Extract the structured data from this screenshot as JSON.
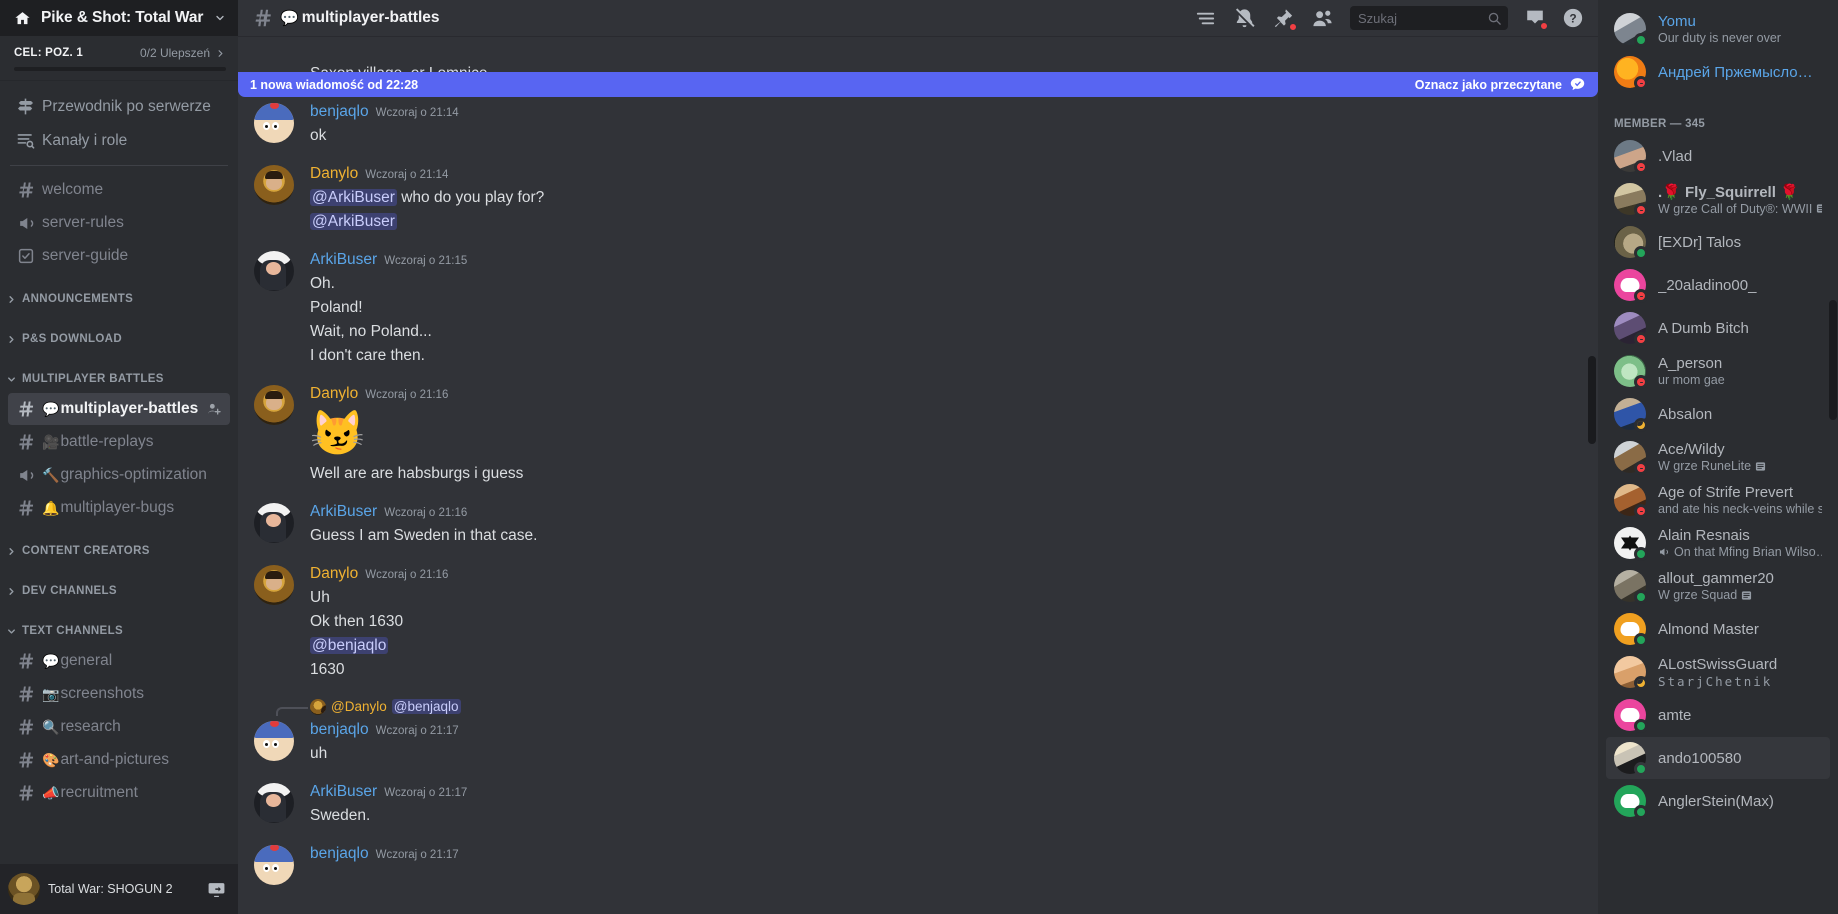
{
  "sidebar": {
    "server_name": "Pike & Shot: Total War",
    "quest": {
      "label": "CEL: POZ. 1",
      "count": "0/2 Ulepszeń"
    },
    "nav": [
      {
        "label": "Przewodnik po serwerze",
        "icon": "signpost-icon"
      },
      {
        "label": "Kanały i role",
        "icon": "channels-and-roles-icon"
      }
    ],
    "top_channels": [
      {
        "name": "welcome",
        "icon": "hash-icon",
        "emoji": ""
      },
      {
        "name": "server-rules",
        "icon": "announcement-icon",
        "emoji": ""
      },
      {
        "name": "server-guide",
        "icon": "guide-icon",
        "emoji": ""
      }
    ],
    "categories": [
      {
        "label": "ANNOUNCEMENTS",
        "open": false,
        "channels": []
      },
      {
        "label": "P&S DOWNLOAD",
        "open": false,
        "channels": []
      },
      {
        "label": "MULTIPLAYER BATTLES",
        "open": true,
        "channels": [
          {
            "name": "multiplayer-battles",
            "icon": "hash-icon",
            "emoji": "💬",
            "active": true,
            "extra": "add-member-icon"
          },
          {
            "name": "battle-replays",
            "icon": "hash-icon",
            "emoji": "🎥",
            "active": false
          },
          {
            "name": "graphics-optimization",
            "icon": "announcement-icon",
            "emoji": "🔨",
            "active": false
          },
          {
            "name": "multiplayer-bugs",
            "icon": "hash-icon",
            "emoji": "🔔",
            "active": false
          }
        ]
      },
      {
        "label": "CONTENT CREATORS",
        "open": false,
        "channels": []
      },
      {
        "label": "DEV CHANNELS",
        "open": false,
        "channels": []
      },
      {
        "label": "TEXT CHANNELS",
        "open": true,
        "channels": [
          {
            "name": "general",
            "icon": "hash-icon",
            "emoji": "💬",
            "active": false
          },
          {
            "name": "screenshots",
            "icon": "hash-icon",
            "emoji": "📷",
            "active": false
          },
          {
            "name": "research",
            "icon": "hash-icon",
            "emoji": "🔍",
            "active": false
          },
          {
            "name": "art-and-pictures",
            "icon": "hash-icon",
            "emoji": "🎨",
            "active": false
          },
          {
            "name": "recruitment",
            "icon": "hash-icon",
            "emoji": "📣",
            "active": false
          }
        ]
      }
    ],
    "user_panel": {
      "game": "Total War: SHOGUN 2",
      "share_icon": "screen-share-icon"
    }
  },
  "topbar": {
    "hash_icon": "hash-icon",
    "channel_emoji": "💬",
    "channel_name": "multiplayer-battles",
    "actions": [
      {
        "name": "threads-icon"
      },
      {
        "name": "notifications-muted-icon",
        "badge": true
      },
      {
        "name": "pinned-messages-icon",
        "badge": true
      },
      {
        "name": "member-list-icon"
      }
    ],
    "search": {
      "placeholder": "Szukaj",
      "value": "",
      "icon": "search-icon"
    },
    "inbox": {
      "name": "inbox-icon",
      "badge": true
    },
    "help": {
      "name": "help-icon"
    }
  },
  "new_messages_banner": {
    "left": "1 nowa wiadomość od 22:28",
    "right": "Oznacz jako przeczytane",
    "icon": "mark-read-icon",
    "color": "#5865f2"
  },
  "chat": {
    "top_partial_line": "Saxon village, or Lomnice",
    "messages": [
      {
        "author": "benjaqlo",
        "author_class": "benjaqlo",
        "avatar": "a-stan",
        "timestamp": "Wczoraj o 21:14",
        "lines": [
          {
            "type": "text",
            "text": "ok"
          }
        ]
      },
      {
        "author": "Danylo",
        "author_class": "danylo",
        "avatar": "a-danylo",
        "timestamp": "Wczoraj o 21:14",
        "lines": [
          {
            "type": "mention_text",
            "mention": "@ArkiBuser",
            "text": " who do you play for?"
          },
          {
            "type": "mention_only",
            "mention": "@ArkiBuser"
          }
        ]
      },
      {
        "author": "ArkiBuser",
        "author_class": "arkibuser",
        "avatar": "a-arki",
        "timestamp": "Wczoraj o 21:15",
        "lines": [
          {
            "type": "text",
            "text": "Oh."
          },
          {
            "type": "text",
            "text": "Poland!"
          },
          {
            "type": "text",
            "text": "Wait, no Poland..."
          },
          {
            "type": "text",
            "text": "I don't care then."
          }
        ]
      },
      {
        "author": "Danylo",
        "author_class": "danylo",
        "avatar": "a-danylo",
        "timestamp": "Wczoraj o 21:16",
        "lines": [
          {
            "type": "bigemoji",
            "text": "😼"
          },
          {
            "type": "text",
            "text": "Well are are habsburgs i guess"
          }
        ]
      },
      {
        "author": "ArkiBuser",
        "author_class": "arkibuser",
        "avatar": "a-arki",
        "timestamp": "Wczoraj o 21:16",
        "lines": [
          {
            "type": "text",
            "text": "Guess I am Sweden in that case."
          }
        ]
      },
      {
        "author": "Danylo",
        "author_class": "danylo",
        "avatar": "a-danylo",
        "timestamp": "Wczoraj o 21:16",
        "lines": [
          {
            "type": "text",
            "text": "Uh"
          },
          {
            "type": "text",
            "text": "Ok then 1630"
          },
          {
            "type": "mention_only",
            "mention": "@benjaqlo"
          },
          {
            "type": "text",
            "text": "1630"
          }
        ]
      },
      {
        "author": "benjaqlo",
        "author_class": "benjaqlo",
        "avatar": "a-stan",
        "timestamp": "Wczoraj o 21:17",
        "reply": {
          "avatar": "a-danylo",
          "name": "@Danylo",
          "mention": "@benjaqlo"
        },
        "lines": [
          {
            "type": "text",
            "text": "uh"
          }
        ]
      },
      {
        "author": "ArkiBuser",
        "author_class": "arkibuser",
        "avatar": "a-arki",
        "timestamp": "Wczoraj o 21:17",
        "lines": [
          {
            "type": "text",
            "text": "Sweden."
          }
        ]
      },
      {
        "author": "benjaqlo",
        "author_class": "benjaqlo",
        "avatar": "a-stan",
        "timestamp": "Wczoraj o 21:17",
        "lines": []
      }
    ]
  },
  "members": {
    "above_group": [
      {
        "name": "Yomu",
        "sub": "Our duty is never over",
        "status": "online",
        "avatar": "a-yomu",
        "name_class": "blue"
      },
      {
        "name": "Андрей Пржемысло…",
        "sub": "",
        "status": "dnd",
        "avatar": "a-andrey",
        "name_class": "blue"
      }
    ],
    "group_title": "MEMBER — 345",
    "list": [
      {
        "name": ".Vlad",
        "sub": "",
        "status": "dnd",
        "avatar": "a-vlad",
        "name_class": "bright"
      },
      {
        "name": ".🌹 Fly_Squirrell 🌹",
        "sub": "W grze Call of Duty®: WWII",
        "sub_icon": "game-detail-icon",
        "status": "dnd",
        "avatar": "a-fly",
        "name_class": "bright",
        "bold": true
      },
      {
        "name": "[EXDr] Talos",
        "sub": "",
        "status": "online",
        "avatar": "a-talos",
        "name_class": "bright"
      },
      {
        "name": "_20aladino00_",
        "sub": "",
        "status": "dnd",
        "avatar": "a-dis-pink",
        "name_class": "bright"
      },
      {
        "name": "A Dumb Bitch",
        "sub": "",
        "status": "dnd",
        "avatar": "a-dumb",
        "name_class": "bright"
      },
      {
        "name": "A_person",
        "sub": "ur mom gae",
        "status": "dnd",
        "avatar": "a-person",
        "name_class": "bright"
      },
      {
        "name": "Absalon",
        "sub": "",
        "status": "idle",
        "avatar": "a-absalon",
        "name_class": "bright"
      },
      {
        "name": "Ace/Wildy",
        "sub": "W grze RuneLite",
        "sub_icon": "game-detail-icon",
        "status": "dnd",
        "avatar": "a-ace",
        "name_class": "bright"
      },
      {
        "name": "Age of Strife Prevert",
        "sub": "and ate his neck-veins while s…",
        "status": "dnd",
        "avatar": "a-strife",
        "name_class": "bright"
      },
      {
        "name": "Alain Resnais",
        "sub": "On that Mfing Brian Wilso…",
        "sub_icon": "voice-icon",
        "status": "online",
        "avatar": "a-alain",
        "name_class": "bright"
      },
      {
        "name": "allout_gammer20",
        "sub": "W grze Squad",
        "sub_icon": "game-detail-icon",
        "status": "online",
        "avatar": "a-allout",
        "name_class": "bright"
      },
      {
        "name": "Almond Master",
        "sub": "",
        "status": "online",
        "avatar": "a-dis-orange",
        "name_class": "bright"
      },
      {
        "name": "ALostSwissGuard",
        "sub": "StarjChetnik",
        "sub_mono": true,
        "status": "idle",
        "avatar": "a-swiss",
        "name_class": "bright"
      },
      {
        "name": "amte",
        "sub": "",
        "status": "online",
        "avatar": "a-dis-pink",
        "name_class": "bright"
      },
      {
        "name": "ando100580",
        "sub": "",
        "status": "online",
        "avatar": "a-ando",
        "name_class": "bright",
        "hover": true
      },
      {
        "name": "AnglerStein(Max)",
        "sub": "",
        "status": "online",
        "avatar": "a-dis-green",
        "name_class": "bright"
      }
    ]
  }
}
